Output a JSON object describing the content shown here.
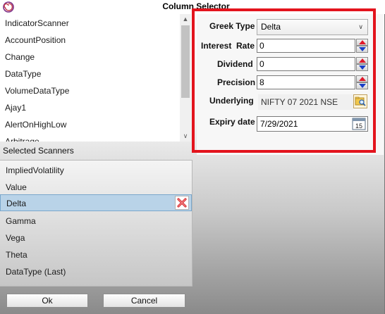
{
  "window": {
    "title": "Column Selector"
  },
  "available_scanners": {
    "items": [
      "IndicatorScanner",
      "AccountPosition",
      "Change",
      "DataType",
      "VolumeDataType",
      "Ajay1",
      "AlertOnHighLow",
      "Arbitrage"
    ]
  },
  "selected_scanners": {
    "label": "Selected Scanners",
    "items": [
      "ImpliedVolatility",
      "Value",
      "Delta",
      "Gamma",
      "Vega",
      "Theta",
      "DataType (Last)"
    ],
    "selected": "Delta"
  },
  "form": {
    "greek_type_label": "Greek Type",
    "greek_type_value": "Delta",
    "interest_rate_label": "Interest  Rate",
    "interest_rate_value": "0",
    "dividend_label": "Dividend",
    "dividend_value": "0",
    "precision_label": "Precision",
    "precision_value": "8",
    "underlying_label": "Underlying",
    "underlying_value": "NIFTY 07 2021 NSE",
    "expiry_label": "Expiry date",
    "expiry_value": "7/29/2021",
    "calendar_day": "15"
  },
  "buttons": {
    "ok": "Ok",
    "cancel": "Cancel"
  },
  "colors": {
    "highlight": "#e3141d",
    "selection": "#b9d3e8"
  }
}
